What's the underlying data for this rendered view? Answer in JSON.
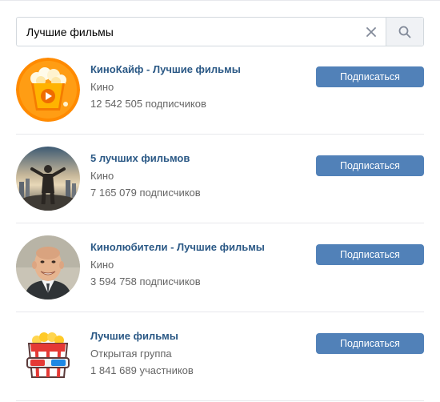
{
  "search": {
    "value": "Лучшие фильмы",
    "placeholder": ""
  },
  "results": [
    {
      "title": "КиноКайф - Лучшие фильмы",
      "category": "Кино",
      "members": "12 542 505 подписчиков",
      "button": "Подписаться",
      "avatar_icon": "popcorn-play-icon"
    },
    {
      "title": "5 лучших фильмов",
      "category": "Кино",
      "members": "7 165 079 подписчиков",
      "button": "Подписаться",
      "avatar_icon": "man-in-city-photo"
    },
    {
      "title": "Кинолюбители - Лучшие фильмы",
      "category": "Кино",
      "members": "3 594 758 подписчиков",
      "button": "Подписаться",
      "avatar_icon": "smiling-man-photo"
    },
    {
      "title": "Лучшие фильмы",
      "category": "Открытая группа",
      "members": "1 841 689 участников",
      "button": "Подписаться",
      "avatar_icon": "popcorn-3d-glasses-icon"
    }
  ],
  "colors": {
    "link": "#2a5885",
    "button": "#5181b8",
    "secondary_text": "#656565",
    "divider": "#e7e8ec"
  }
}
